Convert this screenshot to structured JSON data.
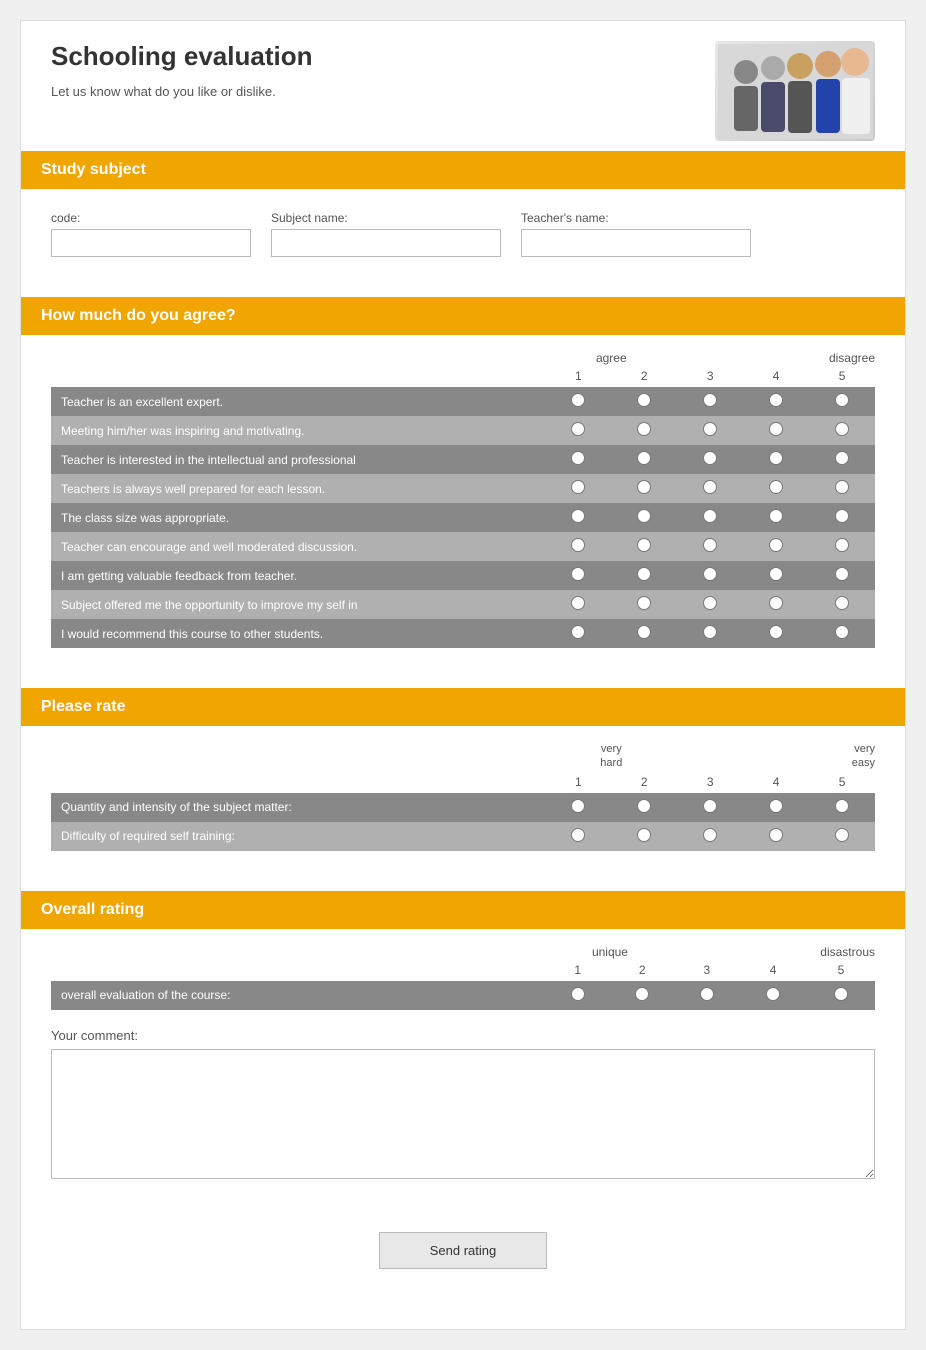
{
  "page": {
    "title": "Schooling evaluation",
    "subtitle": "Let us know what do you like or dislike.",
    "sections": {
      "study_subject": {
        "header": "Study subject",
        "fields": {
          "code": {
            "label": "code:",
            "placeholder": ""
          },
          "subject_name": {
            "label": "Subject name:",
            "placeholder": ""
          },
          "teacher_name": {
            "label": "Teacher's name:",
            "placeholder": ""
          }
        }
      },
      "how_much_agree": {
        "header": "How much do you agree?",
        "left_label": "agree",
        "right_label": "disagree",
        "numbers": [
          "1",
          "2",
          "3",
          "4",
          "5"
        ],
        "rows": [
          "Teacher is an excellent expert.",
          "Meeting him/her was inspiring and motivating.",
          "Teacher is interested in the intellectual and professional",
          "Teachers is always well prepared for each lesson.",
          "The class size was appropriate.",
          "Teacher can encourage and well moderated discussion.",
          "I am getting valuable feedback from teacher.",
          "Subject offered me the opportunity to improve my self in",
          "I would recommend this course to other students."
        ]
      },
      "please_rate": {
        "header": "Please rate",
        "left_label": "very\nhard",
        "right_label": "very\neasy",
        "numbers": [
          "1",
          "2",
          "3",
          "4",
          "5"
        ],
        "rows": [
          "Quantity and intensity of the subject matter:",
          "Difficulty of required self training:"
        ]
      },
      "overall_rating": {
        "header": "Overall rating",
        "left_label": "unique",
        "right_label": "disastrous",
        "numbers": [
          "1",
          "2",
          "3",
          "4",
          "5"
        ],
        "rows": [
          "overall evaluation of the course:"
        ],
        "comment_label": "Your comment:",
        "comment_placeholder": ""
      }
    },
    "submit_button": "Send rating"
  }
}
